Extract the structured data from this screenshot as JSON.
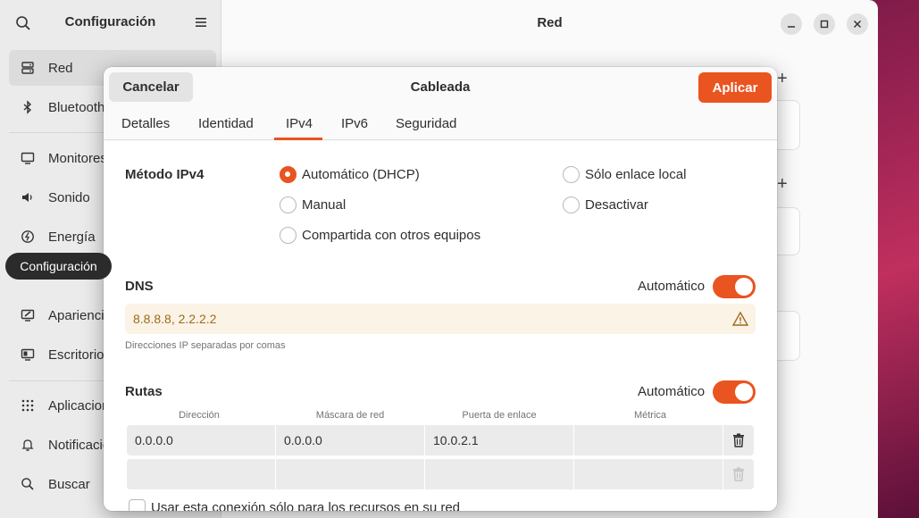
{
  "sidebar": {
    "title": "Configuración",
    "items": [
      {
        "label": "Red",
        "icon": "network-wired-icon",
        "active": true
      },
      {
        "label": "Bluetooth",
        "icon": "bluetooth-icon"
      },
      {
        "label": "Monitores",
        "icon": "display-icon"
      },
      {
        "label": "Sonido",
        "icon": "speaker-icon"
      },
      {
        "label": "Energía",
        "icon": "power-icon"
      },
      {
        "label": "Apariencia",
        "icon": "appearance-icon"
      },
      {
        "label": "Escritorio",
        "icon": "desktop-icon"
      },
      {
        "label": "Aplicaciones",
        "icon": "apps-grid-icon"
      },
      {
        "label": "Notificaciones",
        "icon": "bell-icon"
      },
      {
        "label": "Buscar",
        "icon": "search-icon"
      }
    ]
  },
  "tooltip": "Configuración",
  "main": {
    "title": "Red"
  },
  "dialog": {
    "title": "Cableada",
    "cancel_label": "Cancelar",
    "apply_label": "Aplicar",
    "tabs": [
      "Detalles",
      "Identidad",
      "IPv4",
      "IPv6",
      "Seguridad"
    ],
    "active_tab": "IPv4",
    "method": {
      "label": "Método IPv4",
      "options": [
        "Automático (DHCP)",
        "Sólo enlace local",
        "Manual",
        "Desactivar",
        "Compartida con otros equipos"
      ],
      "selected": "Automático (DHCP)"
    },
    "dns": {
      "label": "DNS",
      "auto_label": "Automático",
      "auto_on": true,
      "value": "8.8.8.8, 2.2.2.2",
      "hint": "Direcciones IP separadas por comas"
    },
    "routes": {
      "label": "Rutas",
      "auto_label": "Automático",
      "auto_on": true,
      "columns": [
        "Dirección",
        "Máscara de red",
        "Puerta de enlace",
        "Métrica"
      ],
      "rows": [
        [
          "0.0.0.0",
          "0.0.0.0",
          "10.0.2.1",
          ""
        ],
        [
          "",
          "",
          "",
          ""
        ]
      ]
    },
    "restrict_label": "Usar esta conexión sólo para los recursos en su red"
  },
  "colors": {
    "accent": "#e95420"
  }
}
